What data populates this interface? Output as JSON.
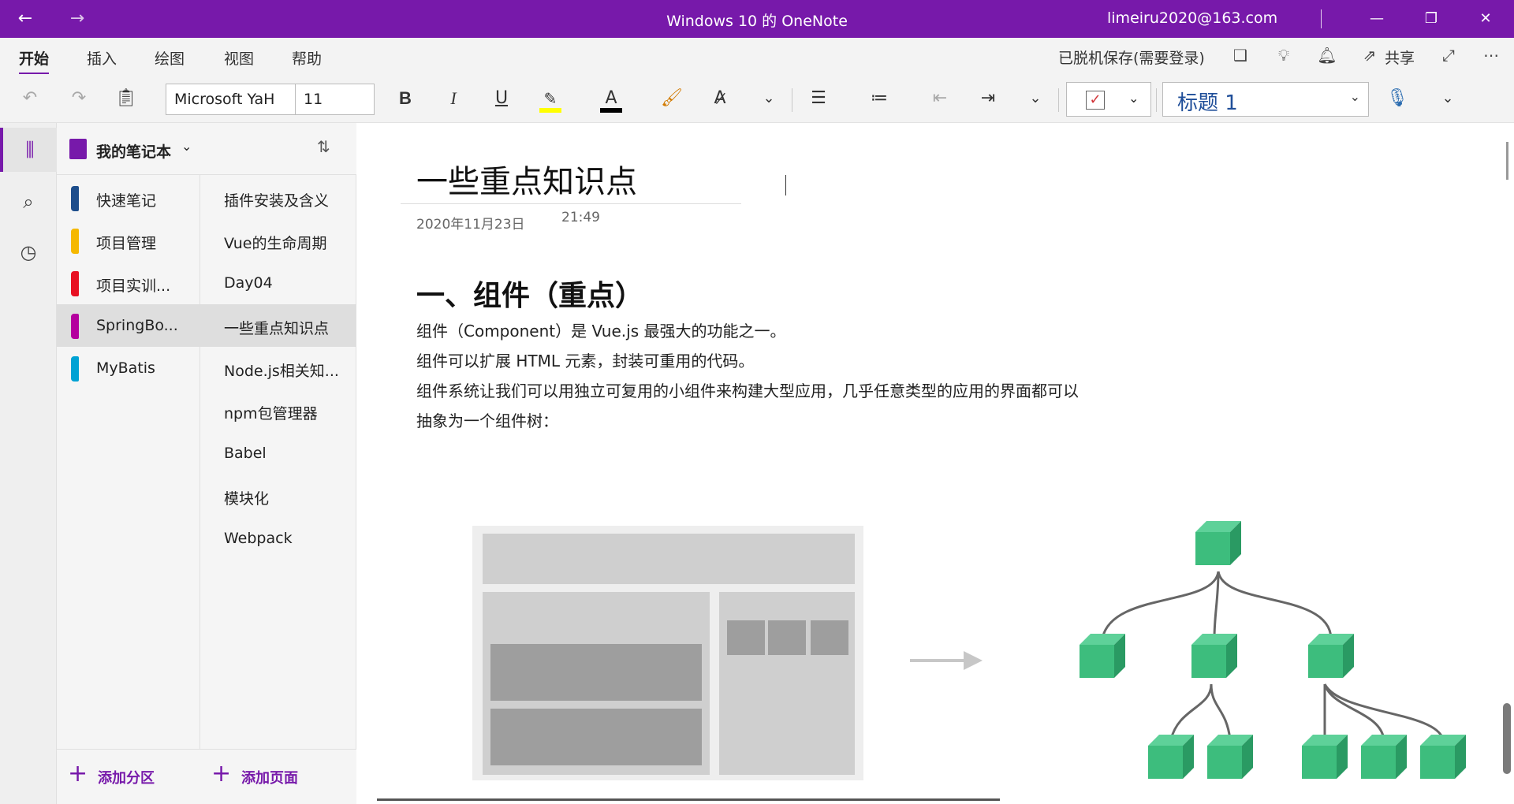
{
  "window": {
    "title": "Windows 10 的 OneNote",
    "account": "limeiru2020@163.com"
  },
  "ribbon": {
    "tabs": [
      "开始",
      "插入",
      "绘图",
      "视图",
      "帮助"
    ],
    "status": "已脱机保存(需要登录)",
    "share_label": "共享"
  },
  "toolbar": {
    "font_name": "Microsoft YaH",
    "font_size": "11",
    "style": "标题 1",
    "highlight_color": "#ffff00",
    "font_color": "#000000"
  },
  "notebook": {
    "name": "我的笔记本",
    "sections": [
      {
        "label": "快速笔记",
        "color": "#1e4e8c"
      },
      {
        "label": "项目管理",
        "color": "#f5b800"
      },
      {
        "label": "项目实训...",
        "color": "#e81123"
      },
      {
        "label": "SpringBo...",
        "color": "#b4009e"
      },
      {
        "label": "MyBatis",
        "color": "#00a2d4"
      }
    ],
    "pages": [
      "插件安装及含义",
      "Vue的生命周期",
      "Day04",
      "一些重点知识点",
      "Node.js相关知...",
      "npm包管理器",
      "Babel",
      "模块化",
      "Webpack"
    ],
    "add_section": "添加分区",
    "add_page": "添加页面"
  },
  "page": {
    "title": "一些重点知识点",
    "date": "2020年11月23日",
    "time": "21:49",
    "heading": "一、组件（重点）",
    "paragraphs": [
      "组件（Component）是 Vue.js 最强大的功能之一。",
      "组件可以扩展 HTML 元素，封装可重用的代码。",
      "组件系统让我们可以用独立可复用的小组件来构建大型应用，几乎任意类型的应用的界面都可以",
      "抽象为一个组件树："
    ]
  },
  "colors": {
    "accent": "#7719aa",
    "cube": "#3dbd7d"
  }
}
